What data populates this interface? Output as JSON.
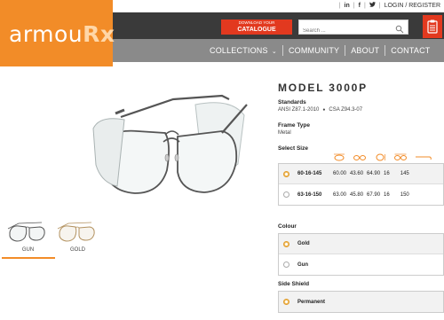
{
  "topbar": {
    "login_label": "LOGIN / REGISTER",
    "social": [
      "in",
      "f",
      "t"
    ]
  },
  "brand": {
    "logo_main": "armou",
    "logo_suffix": "Rx",
    "accent_color": "#f28c28",
    "cta_color": "#e2391f"
  },
  "header": {
    "download_line1": "DOWNLOAD YOUR",
    "download_line2": "CATALOGUE",
    "search_placeholder": "Search ..."
  },
  "nav": {
    "items": [
      "COLLECTIONS",
      "COMMUNITY",
      "ABOUT",
      "CONTACT"
    ]
  },
  "thumbnails": [
    {
      "label": "GUN",
      "active": true
    },
    {
      "label": "GOLD",
      "active": false
    }
  ],
  "product": {
    "title": "MODEL 3000P",
    "standards_label": "Standards",
    "standards": [
      "ANSI Z87.1-2010",
      "CSA Z94.3-07"
    ],
    "frame_type_label": "Frame Type",
    "frame_type": "Metal",
    "select_size_label": "Select Size",
    "frame_icons": [
      "lens-width-icon",
      "bridge-icon",
      "lens-height-icon",
      "frame-width-icon",
      "temple-length-icon"
    ],
    "sizes": [
      {
        "code": "60-16-145",
        "values": [
          "60.00",
          "43.60",
          "64.90",
          "16",
          "145"
        ],
        "selected": true
      },
      {
        "code": "63-16-150",
        "values": [
          "63.00",
          "45.80",
          "67.90",
          "16",
          "150"
        ],
        "selected": false
      }
    ],
    "colour_label": "Colour",
    "colours": [
      {
        "name": "Gold",
        "selected": true
      },
      {
        "name": "Gun",
        "selected": false
      }
    ],
    "side_shield_label": "Side Shield",
    "side_shields": [
      {
        "name": "Permanent",
        "selected": true
      }
    ]
  }
}
